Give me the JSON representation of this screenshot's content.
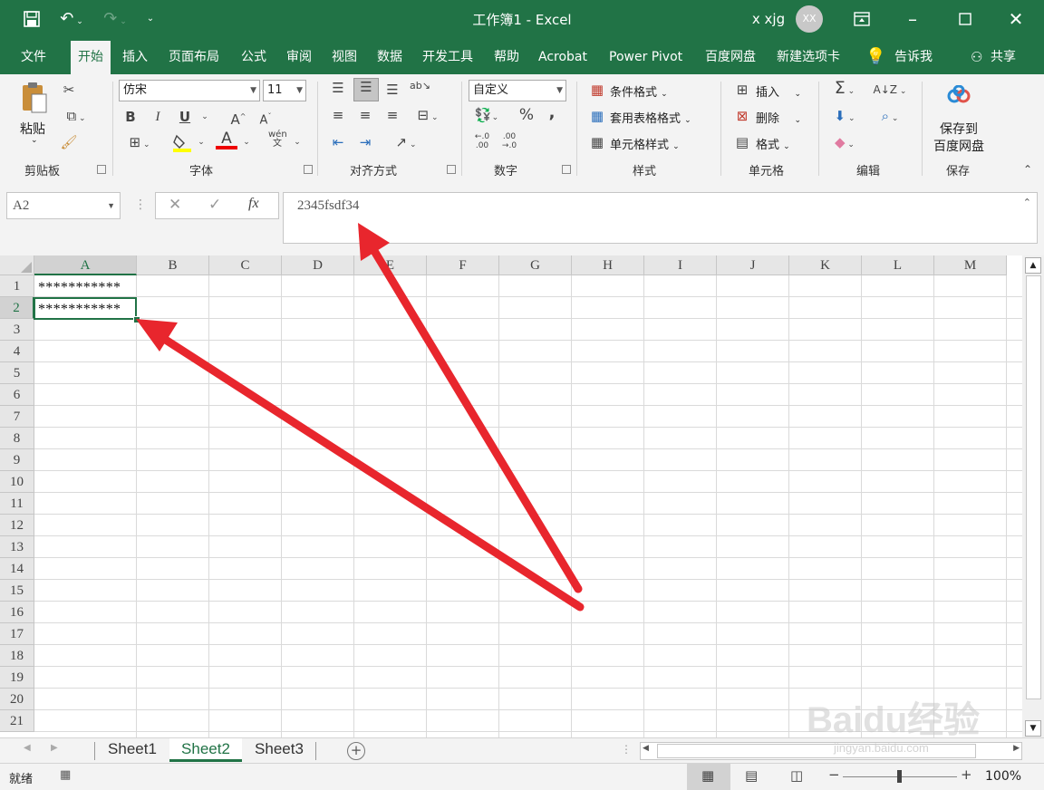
{
  "titlebar": {
    "doc_title": "工作簿1 - Excel",
    "user_name": "x xjg",
    "avatar_initials": "XX"
  },
  "tabs": [
    "文件",
    "开始",
    "插入",
    "页面布局",
    "公式",
    "审阅",
    "视图",
    "数据",
    "开发工具",
    "帮助",
    "Acrobat",
    "Power Pivot",
    "百度网盘",
    "新建选项卡"
  ],
  "active_tab": "开始",
  "tell_me": "告诉我",
  "share": "共享",
  "ribbon": {
    "clipboard": {
      "paste": "粘贴",
      "label": "剪贴板"
    },
    "font": {
      "name": "仿宋",
      "size": "11",
      "label": "字体",
      "bold": "B",
      "italic": "I",
      "underline": "U",
      "font_color_letter": "A",
      "wen": "wén\n文"
    },
    "alignment": {
      "label": "对齐方式"
    },
    "number": {
      "format": "自定义",
      "label": "数字",
      "percent": "%",
      "comma": ","
    },
    "styles": {
      "conditional": "条件格式",
      "table": "套用表格格式",
      "cell": "单元格样式",
      "label": "样式"
    },
    "cells": {
      "insert": "插入",
      "delete": "删除",
      "format": "格式",
      "label": "单元格"
    },
    "editing": {
      "label": "编辑"
    },
    "save": {
      "line1": "保存到",
      "line2": "百度网盘",
      "label": "保存"
    }
  },
  "formula_bar": {
    "name_box": "A2",
    "fx": "fx",
    "content": "2345fsdf34"
  },
  "columns": [
    "A",
    "B",
    "C",
    "D",
    "E",
    "F",
    "G",
    "H",
    "I",
    "J",
    "K",
    "L",
    "M"
  ],
  "rows": [
    "1",
    "2",
    "3",
    "4",
    "5",
    "6",
    "7",
    "8",
    "9",
    "10",
    "11",
    "12",
    "13",
    "14",
    "15",
    "16",
    "17",
    "18",
    "19",
    "20",
    "21"
  ],
  "cells": {
    "A1": "***********",
    "A2": "***********"
  },
  "sheets": [
    "Sheet1",
    "Sheet2",
    "Sheet3"
  ],
  "active_sheet": "Sheet2",
  "status": {
    "ready": "就绪",
    "zoom": "100%",
    "zoom_minus": "−",
    "zoom_plus": "+"
  },
  "watermark": {
    "brand": "Baidu经验",
    "url": "jingyan.baidu.com"
  },
  "colors": {
    "excel_green": "#217346",
    "arrow_red": "#e8262d"
  }
}
